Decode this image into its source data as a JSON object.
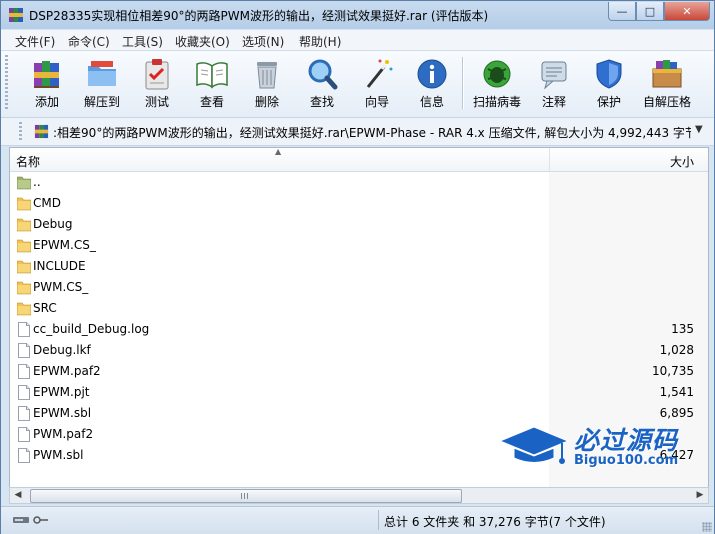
{
  "window": {
    "title": "DSP28335实现相位相差90°的两路PWM波形的输出，经测试效果挺好.rar (评估版本)",
    "controls": {
      "minimize": "—",
      "maximize": "□",
      "close": "✕"
    }
  },
  "menu": [
    {
      "label": "文件(F)"
    },
    {
      "label": "命令(C)"
    },
    {
      "label": "工具(S)"
    },
    {
      "label": "收藏夹(O)"
    },
    {
      "label": "选项(N)"
    },
    {
      "label": "帮助(H)"
    }
  ],
  "toolbar": [
    {
      "label": "添加",
      "icon": "add-books-icon"
    },
    {
      "label": "解压到",
      "icon": "extract-folder-icon"
    },
    {
      "label": "测试",
      "icon": "test-clipboard-icon"
    },
    {
      "label": "查看",
      "icon": "view-book-icon"
    },
    {
      "label": "删除",
      "icon": "trash-icon"
    },
    {
      "label": "查找",
      "icon": "magnifier-icon"
    },
    {
      "label": "向导",
      "icon": "wand-icon"
    },
    {
      "label": "信息",
      "icon": "info-icon"
    },
    {
      "label": "扫描病毒",
      "icon": "virus-scan-icon"
    },
    {
      "label": "注释",
      "icon": "comment-icon"
    },
    {
      "label": "保护",
      "icon": "shield-icon"
    },
    {
      "label": "自解压格",
      "icon": "sfx-box-icon"
    }
  ],
  "address": {
    "text": ":相差90°的两路PWM波形的输出，经测试效果挺好.rar\\EPWM-Phase - RAR 4.x 压缩文件, 解包大小为 4,992,443 字节"
  },
  "columns": {
    "name": "名称",
    "size": "大小"
  },
  "files": [
    {
      "name": "..",
      "size": "",
      "type": "up"
    },
    {
      "name": "CMD",
      "size": "",
      "type": "folder"
    },
    {
      "name": "Debug",
      "size": "",
      "type": "folder"
    },
    {
      "name": "EPWM.CS_",
      "size": "",
      "type": "folder"
    },
    {
      "name": "INCLUDE",
      "size": "",
      "type": "folder"
    },
    {
      "name": "PWM.CS_",
      "size": "",
      "type": "folder"
    },
    {
      "name": "SRC",
      "size": "",
      "type": "folder"
    },
    {
      "name": "cc_build_Debug.log",
      "size": "135",
      "type": "file"
    },
    {
      "name": "Debug.lkf",
      "size": "1,028",
      "type": "file"
    },
    {
      "name": "EPWM.paf2",
      "size": "10,735",
      "type": "file"
    },
    {
      "name": "EPWM.pjt",
      "size": "1,541",
      "type": "file"
    },
    {
      "name": "EPWM.sbl",
      "size": "6,895",
      "type": "file"
    },
    {
      "name": "PWM.paf2",
      "size": "",
      "type": "file"
    },
    {
      "name": "PWM.sbl",
      "size": "6,427",
      "type": "file"
    }
  ],
  "status": {
    "text": "总计 6 文件夹 和 37,276 字节(7 个文件)"
  },
  "watermark": {
    "cn": "必过源码",
    "en": "Biguo100.com"
  },
  "colors": {
    "folder": "#f2c14e",
    "accent": "#1a63c4"
  }
}
